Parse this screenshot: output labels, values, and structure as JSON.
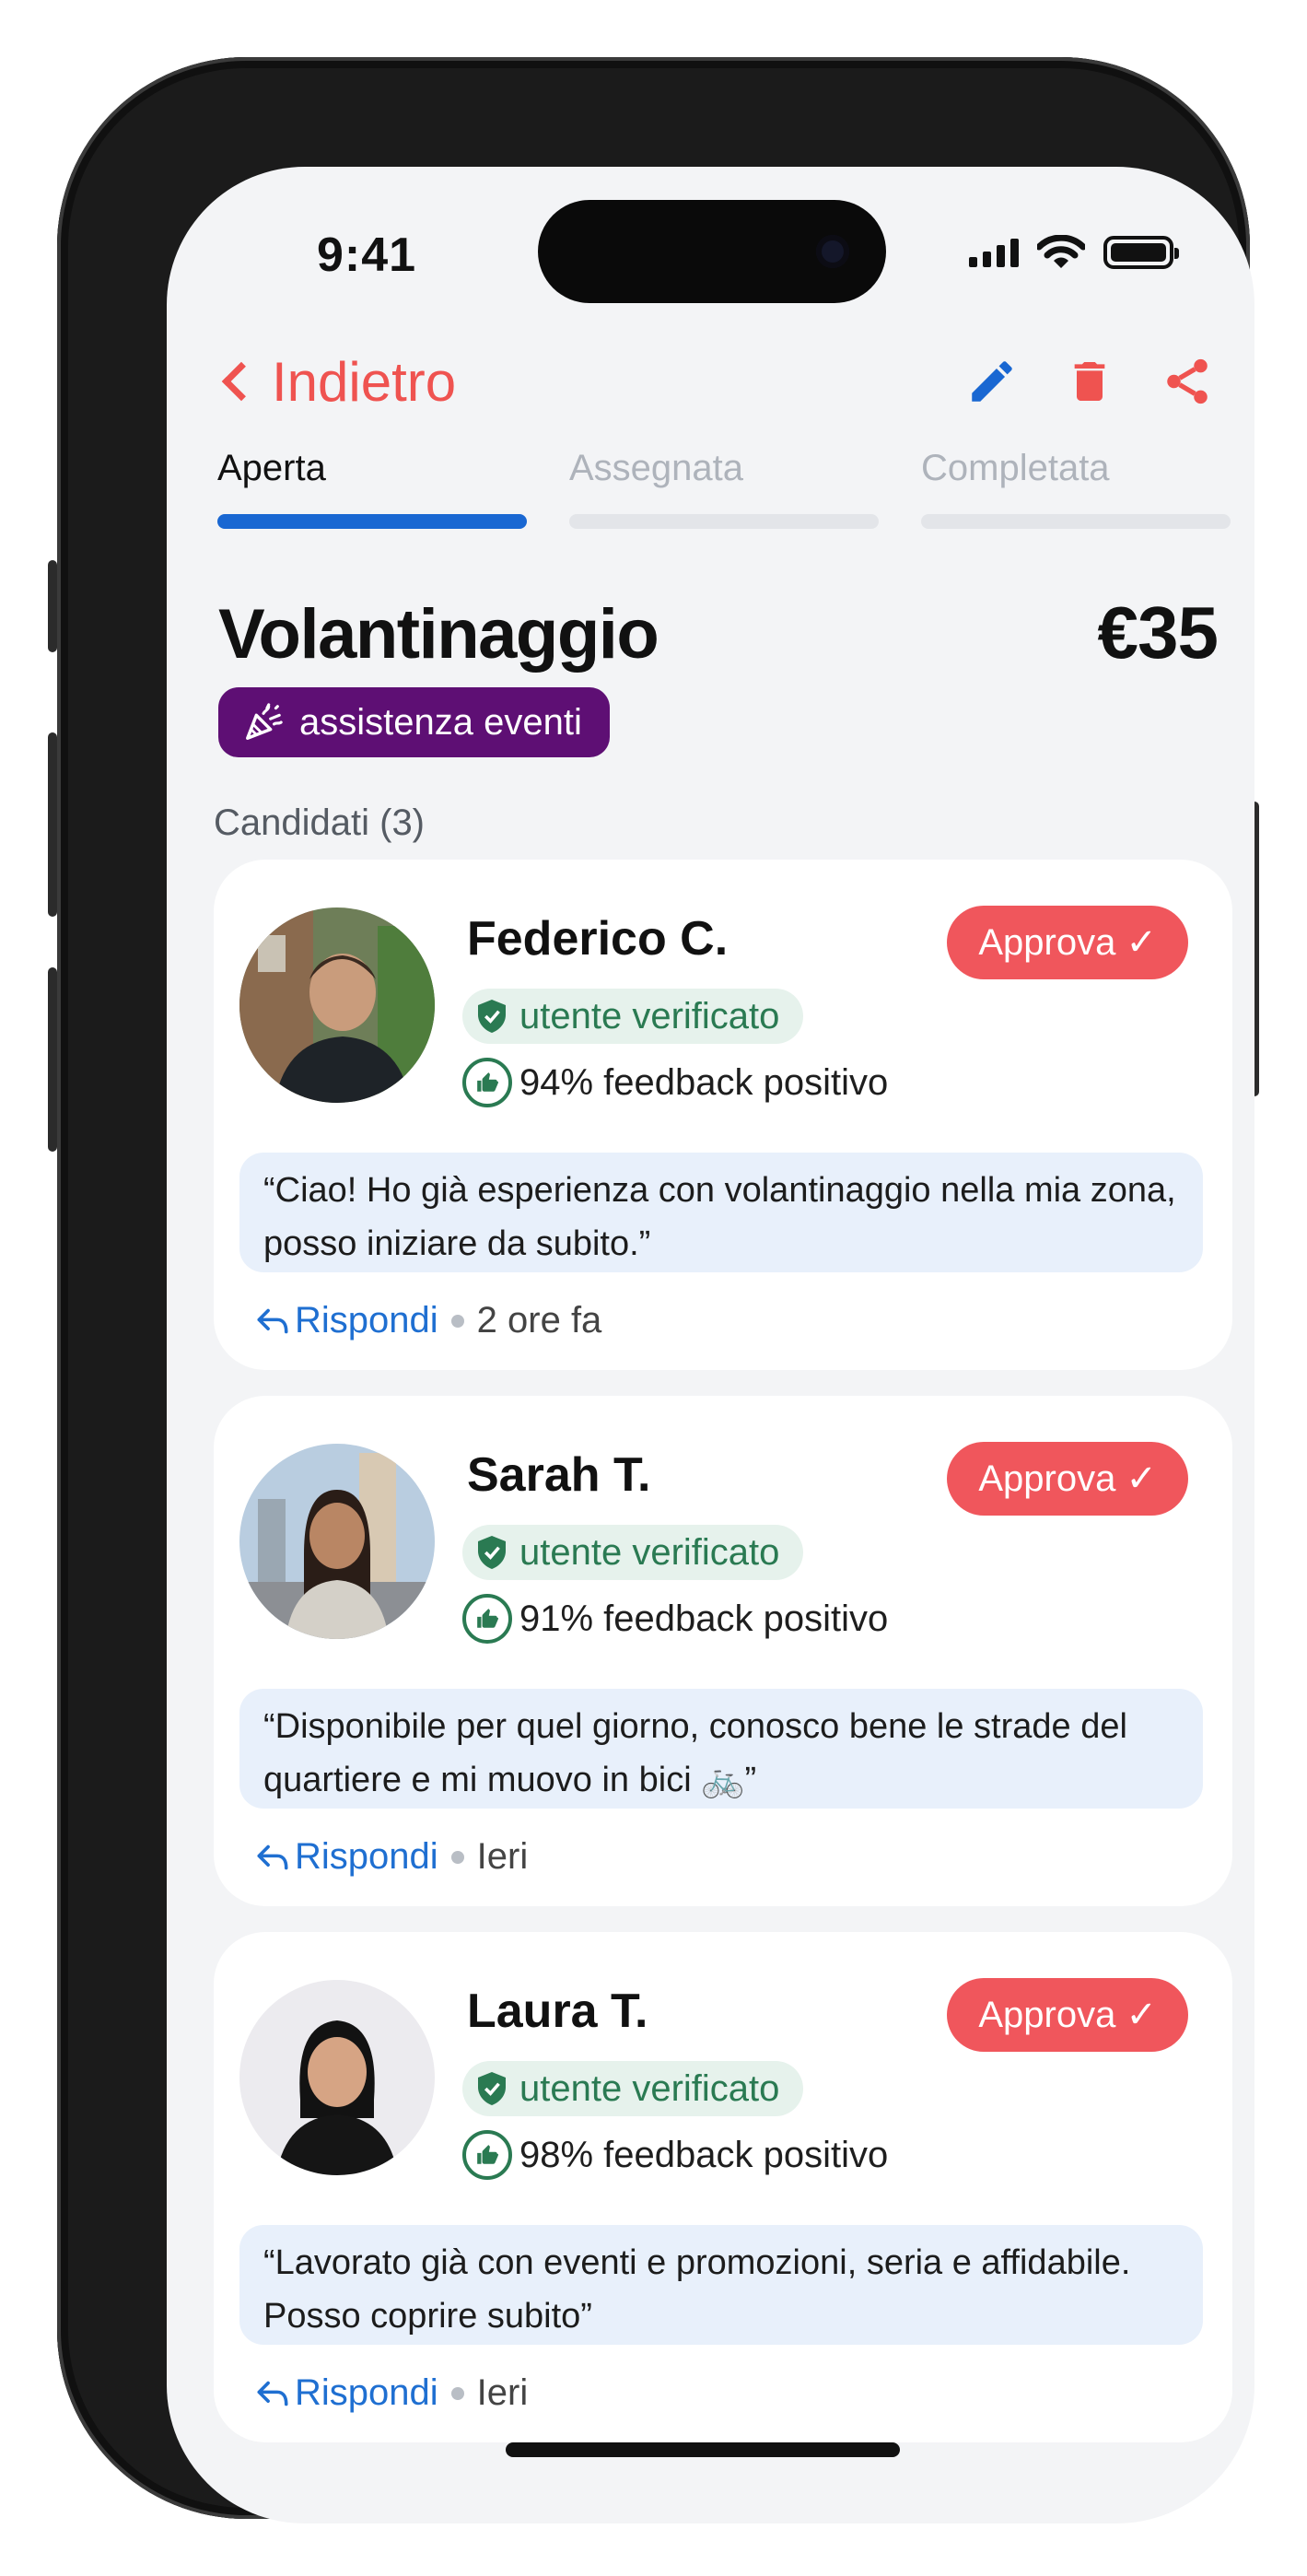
{
  "status_bar": {
    "time": "9:41"
  },
  "nav": {
    "back_label": "Indietro",
    "actions": [
      "pencil-icon",
      "trash-icon",
      "share-icon"
    ]
  },
  "tabs": [
    {
      "label": "Aperta",
      "active": true
    },
    {
      "label": "Assegnata",
      "active": false
    },
    {
      "label": "Completata",
      "active": false
    }
  ],
  "task": {
    "title": "Volantinaggio",
    "price": "€35",
    "category": "assistenza eventi",
    "category_icon": "party-popper-icon"
  },
  "candidates_title": "Candidati (3)",
  "candidates": [
    {
      "name": "Federico C.",
      "approve_label": "Approva ✓",
      "verified_label": "utente verificato",
      "feedback": "94% feedback positivo",
      "message": "“Ciao! Ho già esperienza con volantinaggio nella mia zona, posso iniziare da subito.”",
      "reply_label": "Rispondi",
      "time": "2 ore fa"
    },
    {
      "name": "Sarah T.",
      "approve_label": "Approva ✓",
      "verified_label": "utente verificato",
      "feedback": "91% feedback positivo",
      "message": "“Disponibile per quel giorno, conosco bene le strade del quartiere e mi muovo in bici 🚲”",
      "reply_label": "Rispondi",
      "time": "Ieri"
    },
    {
      "name": "Laura T.",
      "approve_label": "Approva ✓",
      "verified_label": "utente verificato",
      "feedback": "98% feedback positivo",
      "message": "“Lavorato già con eventi e promozioni, seria e affidabile. Posso coprire subito”",
      "reply_label": "Rispondi",
      "time": "Ieri"
    }
  ],
  "colors": {
    "accent_red": "#ef5350",
    "tab_active": "#1967d2",
    "category_bg": "#5e0f74",
    "verified_green": "#2a7a52",
    "reply_blue": "#1f6fd1"
  }
}
